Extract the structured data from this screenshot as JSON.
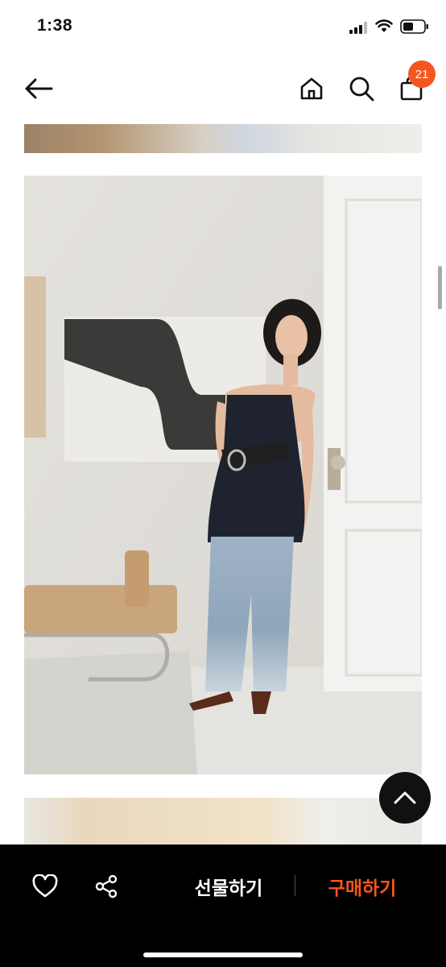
{
  "status_bar": {
    "time": "1:38"
  },
  "header": {
    "back_icon": "arrow-left-icon",
    "home_icon": "home-icon",
    "search_icon": "search-icon",
    "cart_icon": "shopping-bag-icon",
    "cart_count": "21"
  },
  "content": {
    "images": [
      "product-photo-top",
      "product-photo-main",
      "product-photo-bottom"
    ]
  },
  "bottom_bar": {
    "like_icon": "heart-icon",
    "share_icon": "share-icon",
    "gift_label": "선물하기",
    "buy_label": "구매하기"
  },
  "colors": {
    "accent": "#f5561e",
    "bottom_bar_bg": "#000000",
    "badge_bg": "#f5561e"
  }
}
